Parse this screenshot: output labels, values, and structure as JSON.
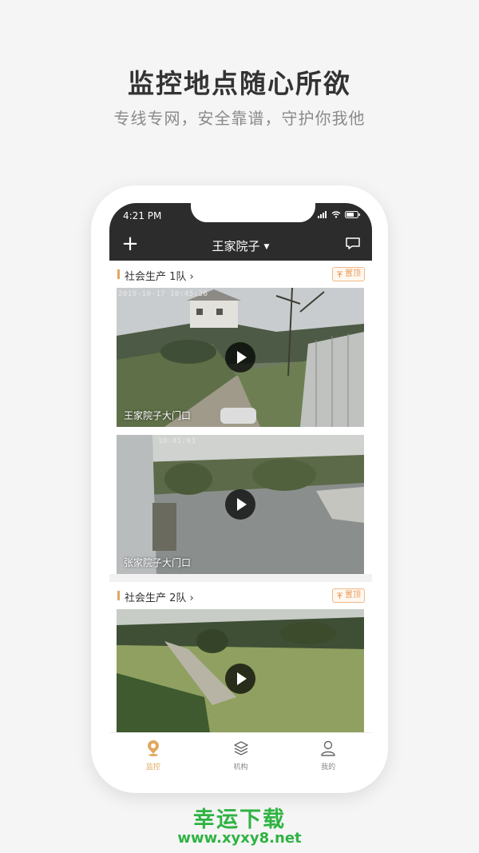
{
  "promo": {
    "headline": "监控地点随心所欲",
    "subline": "专线专网，安全靠谱，守护你我他"
  },
  "status_bar": {
    "time": "4:21 PM",
    "icons": [
      "signal-icon",
      "wifi-icon",
      "battery-icon"
    ]
  },
  "app_bar": {
    "title": "王家院子",
    "add_icon": "plus-icon",
    "dropdown_icon": "caret-down-icon",
    "message_icon": "message-icon"
  },
  "groups": [
    {
      "name": "社会生产 1队",
      "pin_label": "置顶",
      "cameras": [
        {
          "name": "王家院子大门口",
          "timestamp": "2019-10-17  10:45:26"
        },
        {
          "name": "张家院子大门口",
          "timestamp": "10:45:03"
        }
      ]
    },
    {
      "name": "社会生产 2队",
      "pin_label": "置顶",
      "cameras": [
        {
          "name": "",
          "timestamp": ""
        }
      ]
    }
  ],
  "tabs": [
    {
      "label": "监控",
      "icon": "location-pin-icon",
      "active": true
    },
    {
      "label": "机构",
      "icon": "layers-icon",
      "active": false
    },
    {
      "label": "我的",
      "icon": "user-icon",
      "active": false
    }
  ],
  "watermark": {
    "title": "幸运下载",
    "url": "www.xyxy8.net"
  },
  "colors": {
    "accent": "#e0a860",
    "dark_bar": "#2c2c2c",
    "watermark_green": "#2fb343"
  }
}
